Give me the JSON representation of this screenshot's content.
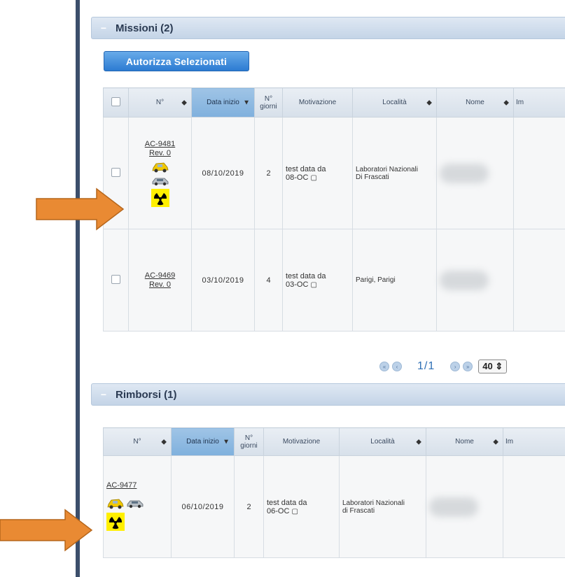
{
  "missioni": {
    "title": "Missioni (2)",
    "authorize_button": "Autorizza Selezionati",
    "columns": [
      "N°",
      "Data inizio",
      "N° giorni",
      "Motivazione",
      "Località",
      "Nome",
      "Im"
    ],
    "rows": [
      {
        "code": "AC-9481",
        "rev": "Rev. 0",
        "date": "08/10/2019",
        "days": "2",
        "reason_line1": "test data da",
        "reason_line2": "08-OC",
        "location_line1": "Laboratori Nazionali",
        "location_line2": "Di Frascati",
        "icons": [
          "taxi-icon",
          "car-icon",
          "radiation-icon"
        ]
      },
      {
        "code": "AC-9469",
        "rev": "Rev. 0",
        "date": "03/10/2019",
        "days": "4",
        "reason_line1": "test data da",
        "reason_line2": "03-OC",
        "location_line1": "Parigi, Parigi",
        "location_line2": "",
        "icons": []
      }
    ],
    "pager": {
      "page": "1/1",
      "per_page": "40"
    }
  },
  "rimborsi": {
    "title": "Rimborsi (1)",
    "columns": [
      "N°",
      "Data inizio",
      "N° giorni",
      "Motivazione",
      "Località",
      "Nome",
      "Im"
    ],
    "rows": [
      {
        "code": "AC-9477",
        "date": "06/10/2019",
        "days": "2",
        "reason_line1": "test data da",
        "reason_line2": "06-OC",
        "location_line1": "Laboratori Nazionali",
        "location_line2": "di Frascati",
        "icons": [
          "taxi-icon",
          "car-icon",
          "radiation-icon"
        ]
      }
    ]
  },
  "colors": {
    "arrow": "#e98a33",
    "radiation_bg": "#ffef00",
    "header_sorted": "#8ab6df"
  }
}
